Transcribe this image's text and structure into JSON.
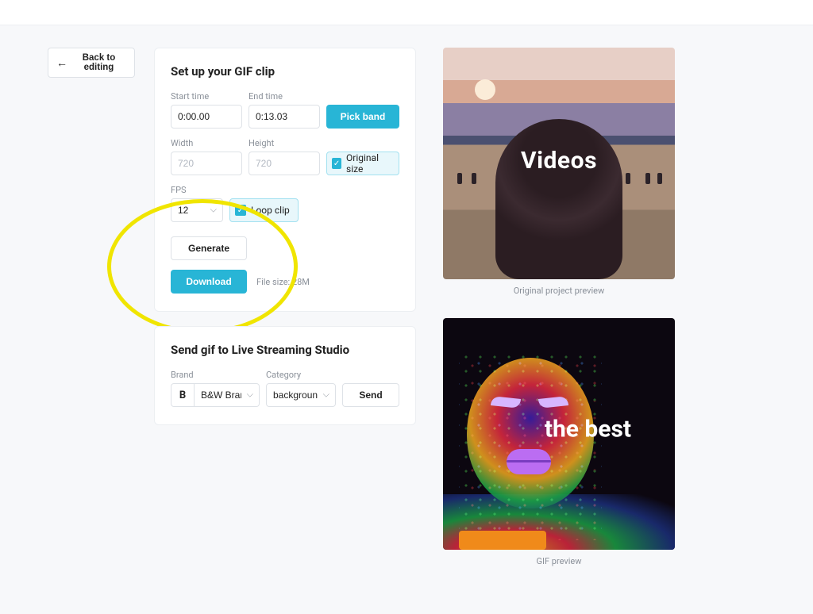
{
  "back_button": "Back to editing",
  "gif_card": {
    "title": "Set up your GIF clip",
    "start_label": "Start time",
    "start_value": "0:00.00",
    "end_label": "End time",
    "end_value": "0:13.03",
    "pick_band": "Pick band",
    "width_label": "Width",
    "width_value": "720",
    "height_label": "Height",
    "height_value": "720",
    "original_size": "Original size",
    "fps_label": "FPS",
    "fps_value": "12",
    "loop_clip": "Loop clip",
    "generate": "Generate",
    "download": "Download",
    "filesize": "File size: 28M"
  },
  "send_card": {
    "title": "Send gif to Live Streaming Studio",
    "brand_label": "Brand",
    "brand_value": "B&W Brand",
    "category_label": "Category",
    "category_value": "background",
    "send": "Send"
  },
  "preview": {
    "original_text": "Videos",
    "original_caption": "Original project preview",
    "gif_text": "the best",
    "gif_caption": "GIF preview"
  }
}
